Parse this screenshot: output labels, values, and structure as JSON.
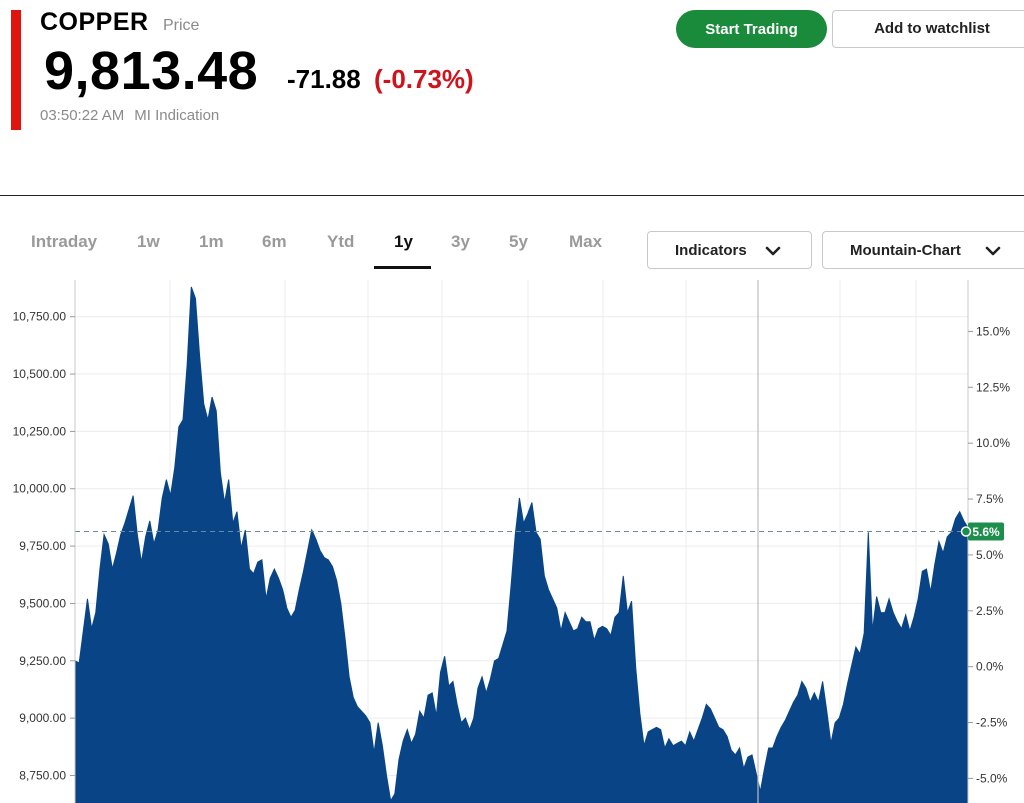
{
  "header": {
    "symbol": "COPPER",
    "symbol_sub": "Price",
    "price": "9,813.48",
    "change_abs": "-71.88",
    "change_pct": "(-0.73%)",
    "time": "03:50:22 AM",
    "source": "MI Indication",
    "accent_color": "#e0140f",
    "change_color": "#d0121b"
  },
  "actions": {
    "start_trading": "Start Trading",
    "add_watchlist": "Add to watchlist",
    "start_color": "#1a8b3a"
  },
  "tabs": [
    {
      "label": "Intraday"
    },
    {
      "label": "1w"
    },
    {
      "label": "1m"
    },
    {
      "label": "6m"
    },
    {
      "label": "Ytd"
    },
    {
      "label": "1y",
      "active": true
    },
    {
      "label": "3y"
    },
    {
      "label": "5y"
    },
    {
      "label": "Max"
    }
  ],
  "controls": {
    "indicators": "Indicators",
    "chart_type": "Mountain-Chart"
  },
  "chart_data": {
    "type": "area",
    "fill_color": "#094586",
    "reference_color": "#1e8e4c",
    "grid": true,
    "y_left": {
      "min": 8630,
      "max": 10910,
      "ticks": [
        8750,
        9000,
        9250,
        9500,
        9750,
        10000,
        10250,
        10500,
        10750
      ],
      "tick_labels": [
        "8,750.00",
        "9,000.00",
        "9,250.00",
        "9,500.00",
        "9,750.00",
        "10,000.00",
        "10,250.00",
        "10,500.00",
        "10,750.00"
      ]
    },
    "y_right": {
      "min": -6.1,
      "max": 17.3,
      "ticks": [
        -5.0,
        -2.5,
        0.0,
        2.5,
        5.0,
        7.5,
        10.0,
        12.5,
        15.0
      ],
      "tick_labels": [
        "-5.0%",
        "-2.5%",
        "0.0%",
        "2.5%",
        "5.0%",
        "7.5%",
        "10.0%",
        "12.5%",
        "15.0%"
      ]
    },
    "reference_value": 9813.48,
    "current_label": "5.6%",
    "values": [
      9250,
      9240,
      9380,
      9520,
      9390,
      9460,
      9650,
      9800,
      9760,
      9650,
      9720,
      9800,
      9850,
      9910,
      9970,
      9800,
      9680,
      9790,
      9860,
      9760,
      9820,
      9960,
      10040,
      9970,
      10090,
      10270,
      10300,
      10540,
      10880,
      10830,
      10580,
      10370,
      10300,
      10400,
      10340,
      10070,
      9940,
      10040,
      9850,
      9900,
      9740,
      9820,
      9650,
      9630,
      9680,
      9690,
      9520,
      9610,
      9650,
      9610,
      9560,
      9480,
      9440,
      9470,
      9560,
      9640,
      9730,
      9820,
      9780,
      9730,
      9700,
      9690,
      9660,
      9600,
      9500,
      9350,
      9180,
      9090,
      9050,
      9030,
      9010,
      8980,
      8850,
      8980,
      8880,
      8750,
      8640,
      8670,
      8820,
      8900,
      8950,
      8890,
      8930,
      9030,
      9000,
      9100,
      9110,
      9010,
      9200,
      9270,
      9140,
      9160,
      9060,
      8980,
      9000,
      8950,
      9000,
      9130,
      9180,
      9110,
      9170,
      9250,
      9260,
      9320,
      9380,
      9580,
      9800,
      9960,
      9850,
      9890,
      9940,
      9810,
      9780,
      9620,
      9560,
      9520,
      9480,
      9380,
      9460,
      9420,
      9380,
      9390,
      9440,
      9420,
      9420,
      9340,
      9390,
      9400,
      9390,
      9360,
      9440,
      9460,
      9620,
      9460,
      9510,
      9220,
      9020,
      8880,
      8940,
      8950,
      8960,
      8950,
      8870,
      8910,
      8880,
      8890,
      8900,
      8880,
      8940,
      8900,
      8950,
      9000,
      9060,
      9040,
      9000,
      8960,
      8950,
      8920,
      8860,
      8840,
      8870,
      8780,
      8830,
      8840,
      8760,
      8680,
      8780,
      8870,
      8870,
      8920,
      8960,
      8990,
      9030,
      9070,
      9100,
      9160,
      9130,
      9070,
      9110,
      9070,
      9160,
      9030,
      8890,
      8980,
      9000,
      9060,
      9150,
      9230,
      9310,
      9280,
      9370,
      9810,
      9380,
      9530,
      9460,
      9460,
      9520,
      9460,
      9420,
      9390,
      9450,
      9380,
      9440,
      9520,
      9640,
      9650,
      9550,
      9670,
      9770,
      9720,
      9790,
      9810,
      9870,
      9900,
      9860,
      9830
    ]
  }
}
